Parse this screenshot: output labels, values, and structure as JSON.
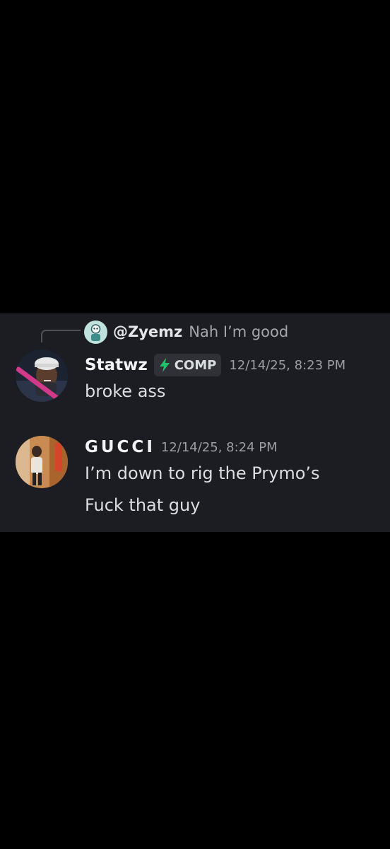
{
  "colors": {
    "background": "#000000",
    "panel": "#1c1d22",
    "tag_bolt": "#23c16b"
  },
  "reply": {
    "author": "@Zyemz",
    "text": "Nah I’m good",
    "avatar": "zyemz-avatar"
  },
  "messages": [
    {
      "author": "Statwz",
      "tag": {
        "icon": "lightning-bolt-icon",
        "label": "COMP"
      },
      "timestamp": "12/14/25, 8:23 PM",
      "lines": [
        "broke ass"
      ],
      "avatar": "statwz-avatar"
    },
    {
      "author": "GUCCI",
      "timestamp": "12/14/25, 8:24 PM",
      "lines": [
        "I’m down to rig the Prymo’s",
        "Fuck that guy"
      ],
      "avatar": "gucci-avatar"
    }
  ]
}
